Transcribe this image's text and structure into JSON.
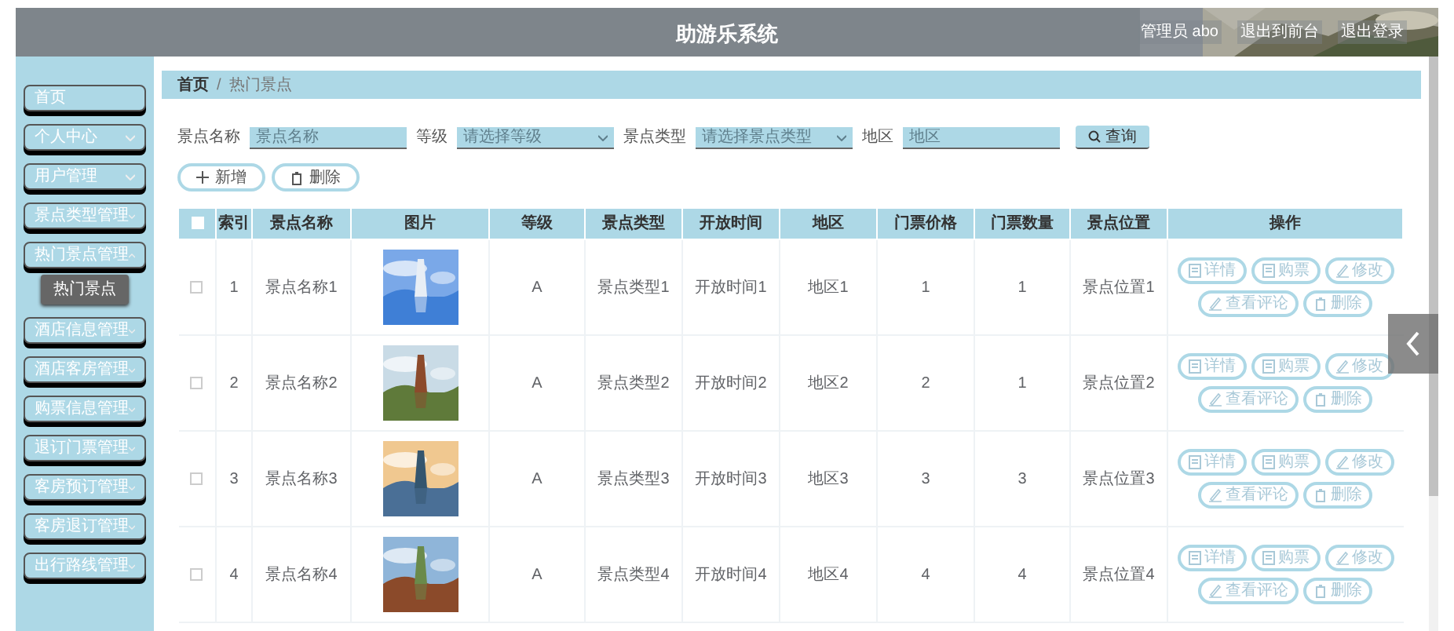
{
  "header": {
    "title": "助游乐系统",
    "links": [
      "管理员 abo",
      "退出到前台",
      "退出登录"
    ]
  },
  "sidebar": {
    "items": [
      {
        "label": "首页",
        "kind": "link"
      },
      {
        "label": "个人中心",
        "kind": "menu",
        "expanded": false
      },
      {
        "label": "用户管理",
        "kind": "menu",
        "expanded": false
      },
      {
        "label": "景点类型管理",
        "kind": "menu",
        "expanded": false
      },
      {
        "label": "热门景点管理",
        "kind": "menu",
        "expanded": true,
        "children": [
          {
            "label": "热门景点"
          }
        ]
      },
      {
        "label": "酒店信息管理",
        "kind": "menu",
        "expanded": false
      },
      {
        "label": "酒店客房管理",
        "kind": "menu",
        "expanded": false
      },
      {
        "label": "购票信息管理",
        "kind": "menu",
        "expanded": false
      },
      {
        "label": "退订门票管理",
        "kind": "menu",
        "expanded": false
      },
      {
        "label": "客房预订管理",
        "kind": "menu",
        "expanded": false
      },
      {
        "label": "客房退订管理",
        "kind": "menu",
        "expanded": false
      },
      {
        "label": "出行路线管理",
        "kind": "menu",
        "expanded": false
      }
    ]
  },
  "breadcrumb": {
    "items": [
      "首页",
      "热门景点"
    ],
    "separator": "/"
  },
  "search": {
    "fields": [
      {
        "label": "景点名称",
        "kind": "input",
        "placeholder": "景点名称"
      },
      {
        "label": "等级",
        "kind": "select",
        "placeholder": "请选择等级"
      },
      {
        "label": "景点类型",
        "kind": "select",
        "placeholder": "请选择景点类型"
      },
      {
        "label": "地区",
        "kind": "input",
        "placeholder": "地区"
      }
    ],
    "button": "查询"
  },
  "toolbar": [
    {
      "label": "新增",
      "kind": "add"
    },
    {
      "label": "删除",
      "kind": "delete"
    }
  ],
  "table": {
    "select_all_checked": false,
    "columns": [
      "索引",
      "景点名称",
      "图片",
      "等级",
      "景点类型",
      "开放时间",
      "地区",
      "门票价格",
      "门票数量",
      "景点位置",
      "操作"
    ],
    "rows": [
      {
        "checked": false,
        "index": "1",
        "name": "景点名称1",
        "level": "A",
        "type": "景点类型1",
        "open_time": "开放时间1",
        "region": "地区1",
        "price": "1",
        "quantity": "1",
        "location": "景点位置1",
        "actions": [
          {
            "label": "详情",
            "kind": "doc"
          },
          {
            "label": "购票",
            "kind": "doc"
          },
          {
            "label": "修改",
            "kind": "edit"
          },
          {
            "label": "查看评论",
            "kind": "edit"
          },
          {
            "label": "删除",
            "kind": "delete"
          }
        ]
      },
      {
        "checked": false,
        "index": "2",
        "name": "景点名称2",
        "level": "A",
        "type": "景点类型2",
        "open_time": "开放时间2",
        "region": "地区2",
        "price": "2",
        "quantity": "1",
        "location": "景点位置2",
        "actions": [
          {
            "label": "详情",
            "kind": "doc"
          },
          {
            "label": "购票",
            "kind": "doc"
          },
          {
            "label": "修改",
            "kind": "edit"
          },
          {
            "label": "查看评论",
            "kind": "edit"
          },
          {
            "label": "删除",
            "kind": "delete"
          }
        ]
      },
      {
        "checked": false,
        "index": "3",
        "name": "景点名称3",
        "level": "A",
        "type": "景点类型3",
        "open_time": "开放时间3",
        "region": "地区3",
        "price": "3",
        "quantity": "3",
        "location": "景点位置3",
        "actions": [
          {
            "label": "详情",
            "kind": "doc"
          },
          {
            "label": "购票",
            "kind": "doc"
          },
          {
            "label": "修改",
            "kind": "edit"
          },
          {
            "label": "查看评论",
            "kind": "edit"
          },
          {
            "label": "删除",
            "kind": "delete"
          }
        ]
      },
      {
        "checked": false,
        "index": "4",
        "name": "景点名称4",
        "level": "A",
        "type": "景点类型4",
        "open_time": "开放时间4",
        "region": "地区4",
        "price": "4",
        "quantity": "4",
        "location": "景点位置4",
        "actions": [
          {
            "label": "详情",
            "kind": "doc"
          },
          {
            "label": "购票",
            "kind": "doc"
          },
          {
            "label": "修改",
            "kind": "edit"
          },
          {
            "label": "查看评论",
            "kind": "edit"
          },
          {
            "label": "删除",
            "kind": "delete"
          }
        ]
      }
    ]
  }
}
